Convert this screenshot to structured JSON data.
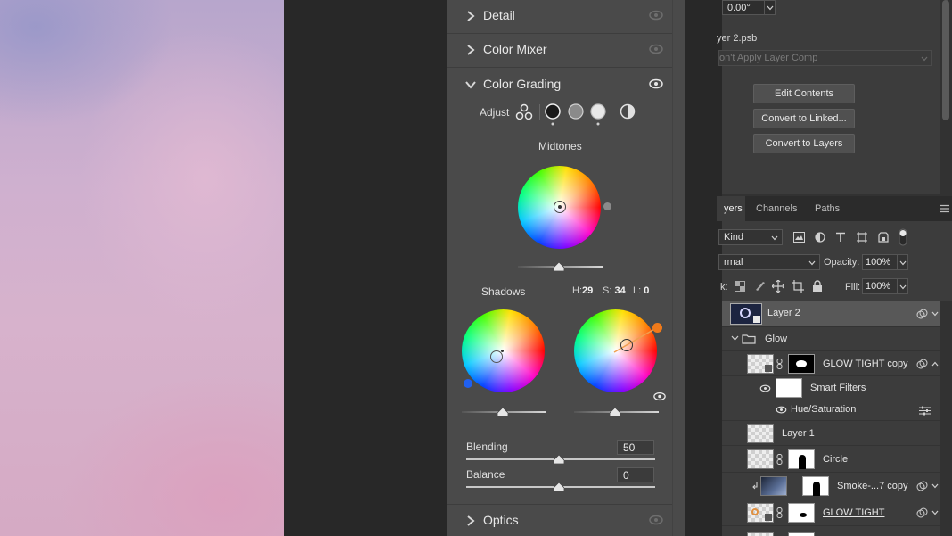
{
  "camera_raw": {
    "sections": {
      "detail": "Detail",
      "color_mixer": "Color Mixer",
      "color_grading": "Color Grading",
      "optics": "Optics"
    },
    "adjust_label": "Adjust",
    "midtones_label": "Midtones",
    "shadows_label": "Shadows",
    "hsl": {
      "h_label": "H:",
      "h": "29",
      "s_label": "S:",
      "s": "34",
      "l_label": "L:",
      "l": "0"
    },
    "blending_label": "Blending",
    "blending_value": "50",
    "balance_label": "Balance",
    "balance_value": "0"
  },
  "properties": {
    "angle_value": "0.00°",
    "file_name": "yer 2.psb",
    "layer_comp_placeholder": "on't Apply Layer Comp",
    "buttons": {
      "edit_contents": "Edit Contents",
      "convert_linked": "Convert to Linked...",
      "convert_layers": "Convert to Layers"
    }
  },
  "layers_panel": {
    "tabs": [
      "yers",
      "Channels",
      "Paths"
    ],
    "filter_kind": "Kind",
    "blend_mode": "rmal",
    "opacity_label": "Opacity:",
    "opacity_value": "100%",
    "lock_label": "k:",
    "fill_label": "Fill:",
    "fill_value": "100%",
    "layers": {
      "layer2": "Layer 2",
      "glow_group": "Glow",
      "glow_tight_copy": "GLOW TIGHT copy",
      "smart_filters": "Smart Filters",
      "hue_sat": "Hue/Saturation",
      "layer1": "Layer 1",
      "circle": "Circle",
      "smoke": "Smoke-...7 copy",
      "glow_tight": "GLOW TIGHT"
    }
  },
  "colors": {
    "accent_orange": "#f07a1a",
    "accent_blue": "#2060f0"
  }
}
